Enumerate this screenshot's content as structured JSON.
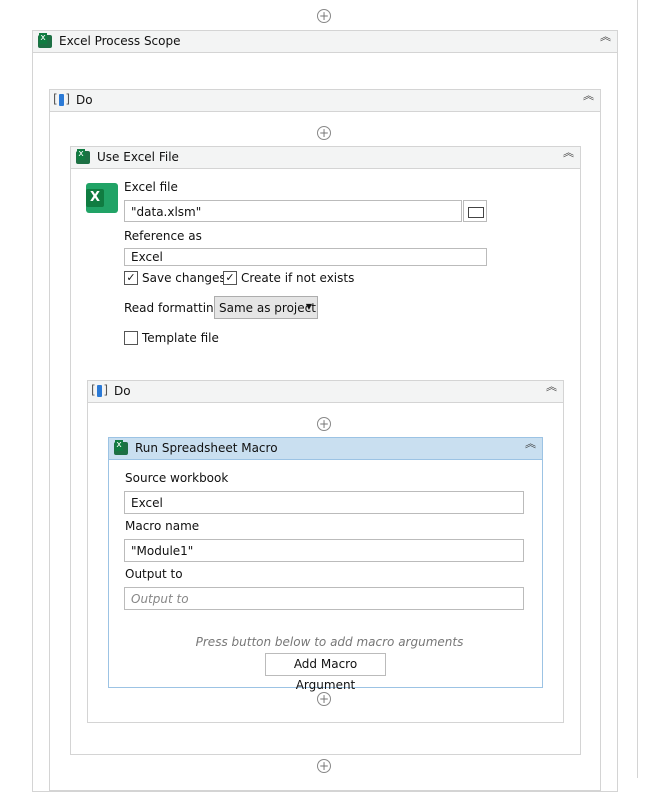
{
  "scope": {
    "title": "Excel Process Scope"
  },
  "do_outer": {
    "title": "Do"
  },
  "use_excel": {
    "title": "Use Excel File",
    "excel_file_label": "Excel file",
    "excel_file_value": "\"data.xlsm\"",
    "reference_label": "Reference as",
    "reference_value": "Excel",
    "save_changes": "Save changes",
    "save_checked": true,
    "create_if_not_exists": "Create if not exists",
    "create_checked": true,
    "read_formatting_label": "Read formatting",
    "read_formatting_value": "Same as project",
    "template_file": "Template file",
    "template_checked": false
  },
  "do_inner": {
    "title": "Do"
  },
  "macro": {
    "title": "Run Spreadsheet Macro",
    "source_label": "Source workbook",
    "source_value": "Excel",
    "macro_label": "Macro name",
    "macro_value": "\"Module1\"",
    "output_label": "Output to",
    "output_placeholder": "Output to",
    "hint": "Press button below to add macro arguments",
    "add_button": "Add Macro Argument"
  },
  "colors": {
    "selected_header": "#c9dff0",
    "excel_green": "#107c41"
  }
}
